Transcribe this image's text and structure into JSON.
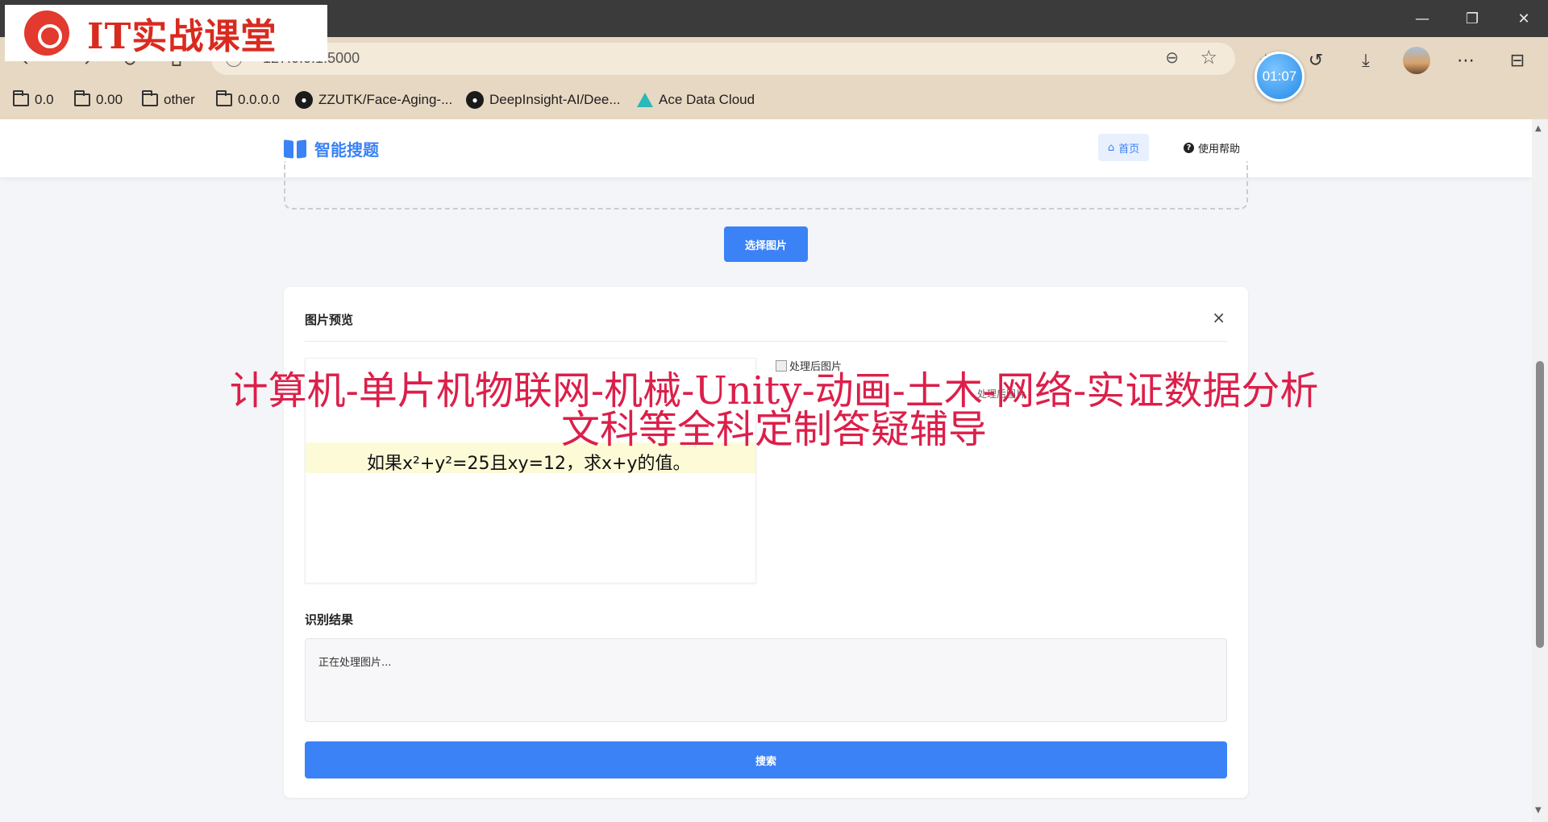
{
  "browser": {
    "url": "127.0.0.1:5000",
    "timer": "01:07",
    "bookmarks": [
      {
        "label": "0.0",
        "icon": "folder-icon"
      },
      {
        "label": "0.00",
        "icon": "folder-icon"
      },
      {
        "label": "other",
        "icon": "folder-icon"
      },
      {
        "label": "0.0.0.0",
        "icon": "folder-icon"
      },
      {
        "label": "ZZUTK/Face-Aging-...",
        "icon": "github-icon"
      },
      {
        "label": "DeepInsight-AI/Dee...",
        "icon": "github-icon"
      },
      {
        "label": "Ace Data Cloud",
        "icon": "ace-data-cloud-icon"
      }
    ]
  },
  "watermark": {
    "logo_text": "IT实战课堂",
    "overlay_line1": "计算机-单片机物联网-机械-Unity-动画-土木-网络-实证数据分析",
    "overlay_line2": "文科等全科定制答疑辅导"
  },
  "header": {
    "brand": "智能搜题",
    "nav_home": "首页",
    "nav_help": "使用帮助"
  },
  "upload": {
    "select_button": "选择图片"
  },
  "preview": {
    "title": "图片预览",
    "close": "×",
    "original_question": "如果x²+y²=25且xy=12，求x+y的值。",
    "processed_alt": "处理后图片",
    "processed_alt_overlap": "处理后图片"
  },
  "result": {
    "title": "识别结果",
    "text": "正在处理图片...",
    "search_button": "搜索"
  },
  "colors": {
    "accent": "#3b82f6",
    "overlay": "#dc1f4a",
    "toolbar": "#e7d8c3"
  }
}
